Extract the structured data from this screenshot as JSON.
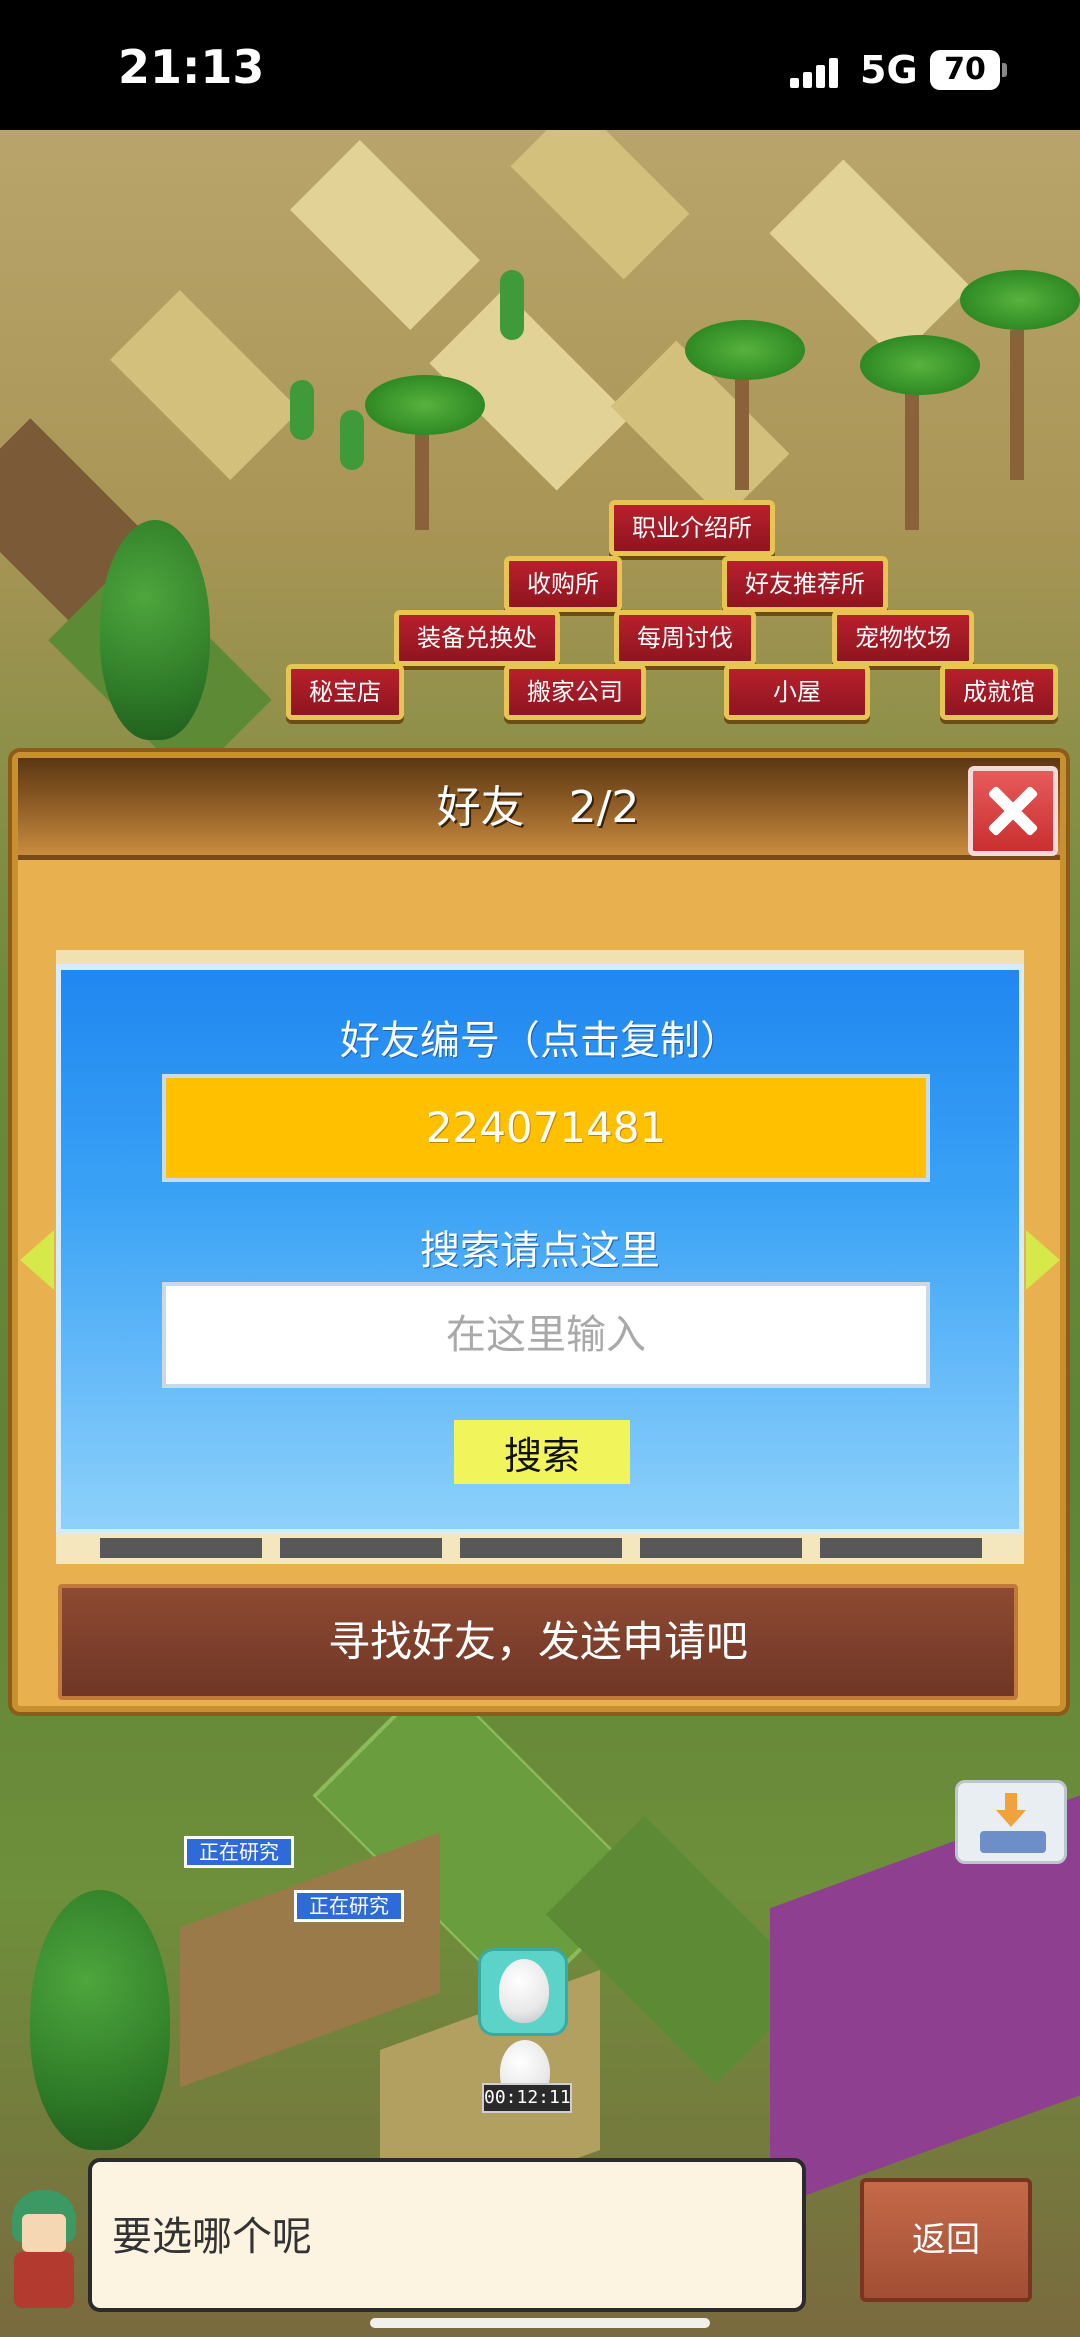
{
  "status_bar": {
    "time": "21:13",
    "network": "5G",
    "battery": "70"
  },
  "buildings": [
    {
      "label": "职业介绍所"
    },
    {
      "label": "收购所"
    },
    {
      "label": "好友推荐所"
    },
    {
      "label": "装备兑换处"
    },
    {
      "label": "每周讨伐"
    },
    {
      "label": "宠物牧场"
    },
    {
      "label": "秘宝店"
    },
    {
      "label": "搬家公司"
    },
    {
      "label": "小屋"
    },
    {
      "label": "成就馆"
    }
  ],
  "game": {
    "research_tag_1": "正在研究",
    "research_tag_2": "正在研究",
    "egg_timer": "00:12:11"
  },
  "dialog": {
    "title": "好友　2/2",
    "friend_id_label": "好友编号（点击复制）",
    "friend_id": "224071481",
    "search_label": "搜索请点这里",
    "search_placeholder": "在这里输入",
    "search_value": "",
    "search_button": "搜索",
    "cta": "寻找好友，发送申请吧"
  },
  "bottom": {
    "message": "要选哪个呢",
    "back_button": "返回"
  },
  "colors": {
    "panel_blue": "#1f87f0",
    "id_box": "#ffc000",
    "search_button": "#f1f45a",
    "cta_bar": "#7a3b2a",
    "close_button": "#d94040"
  }
}
